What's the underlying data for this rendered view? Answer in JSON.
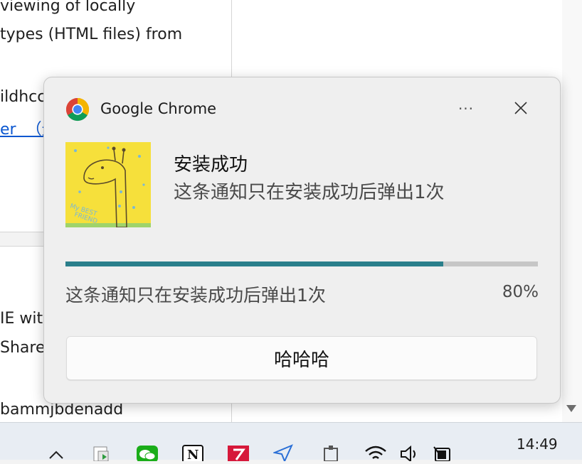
{
  "background": {
    "lines": [
      "viewing of locally",
      "types (HTML files) from",
      "ildhcc",
      "er  （无",
      "IE with",
      "Sharep",
      "bammjbdenadd"
    ]
  },
  "notification": {
    "app_name": "Google Chrome",
    "app_icon": "chrome-logo-icon",
    "more_label": "···",
    "close_icon": "close-icon",
    "image_icon": "giraffe-my-best-friend-image",
    "title": "安装成功",
    "body": "这条通知只在安装成功后弹出1次",
    "progress": {
      "status": "这条通知只在安装成功后弹出1次",
      "value_label": "80%",
      "value": 0.8,
      "color": "#2a7f8b"
    },
    "action_button": "哈哈哈"
  },
  "taskbar": {
    "clock": "14:49",
    "icons": [
      "chevron-up-icon",
      "file-manager-icon",
      "wechat-icon",
      "notion-icon",
      "app-red-icon",
      "send-icon",
      "network-device-icon",
      "wifi-icon",
      "volume-icon",
      "battery-icon"
    ]
  }
}
